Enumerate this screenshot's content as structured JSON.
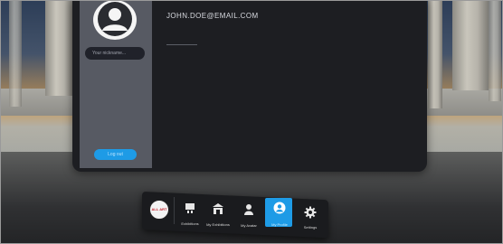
{
  "profile": {
    "email": "JOHN.DOE@EMAIL.COM",
    "nickname_placeholder": "Your nickname...",
    "logout_label": "Log out"
  },
  "logo": {
    "text": "ALL ART"
  },
  "toolbar": {
    "items": [
      {
        "label": "Exhibitions",
        "icon": "exhibitions-icon",
        "active": false
      },
      {
        "label": "My Exhibitions",
        "icon": "gallery-icon",
        "active": false
      },
      {
        "label": "My Avatar",
        "icon": "avatar-icon",
        "active": false
      },
      {
        "label": "My Profile",
        "icon": "profile-icon",
        "active": true
      },
      {
        "label": "Settings",
        "icon": "gear-icon",
        "active": false
      }
    ]
  },
  "colors": {
    "accent": "#1e9be6",
    "panel": "#1d1e22",
    "sidebar": "#575a63"
  }
}
